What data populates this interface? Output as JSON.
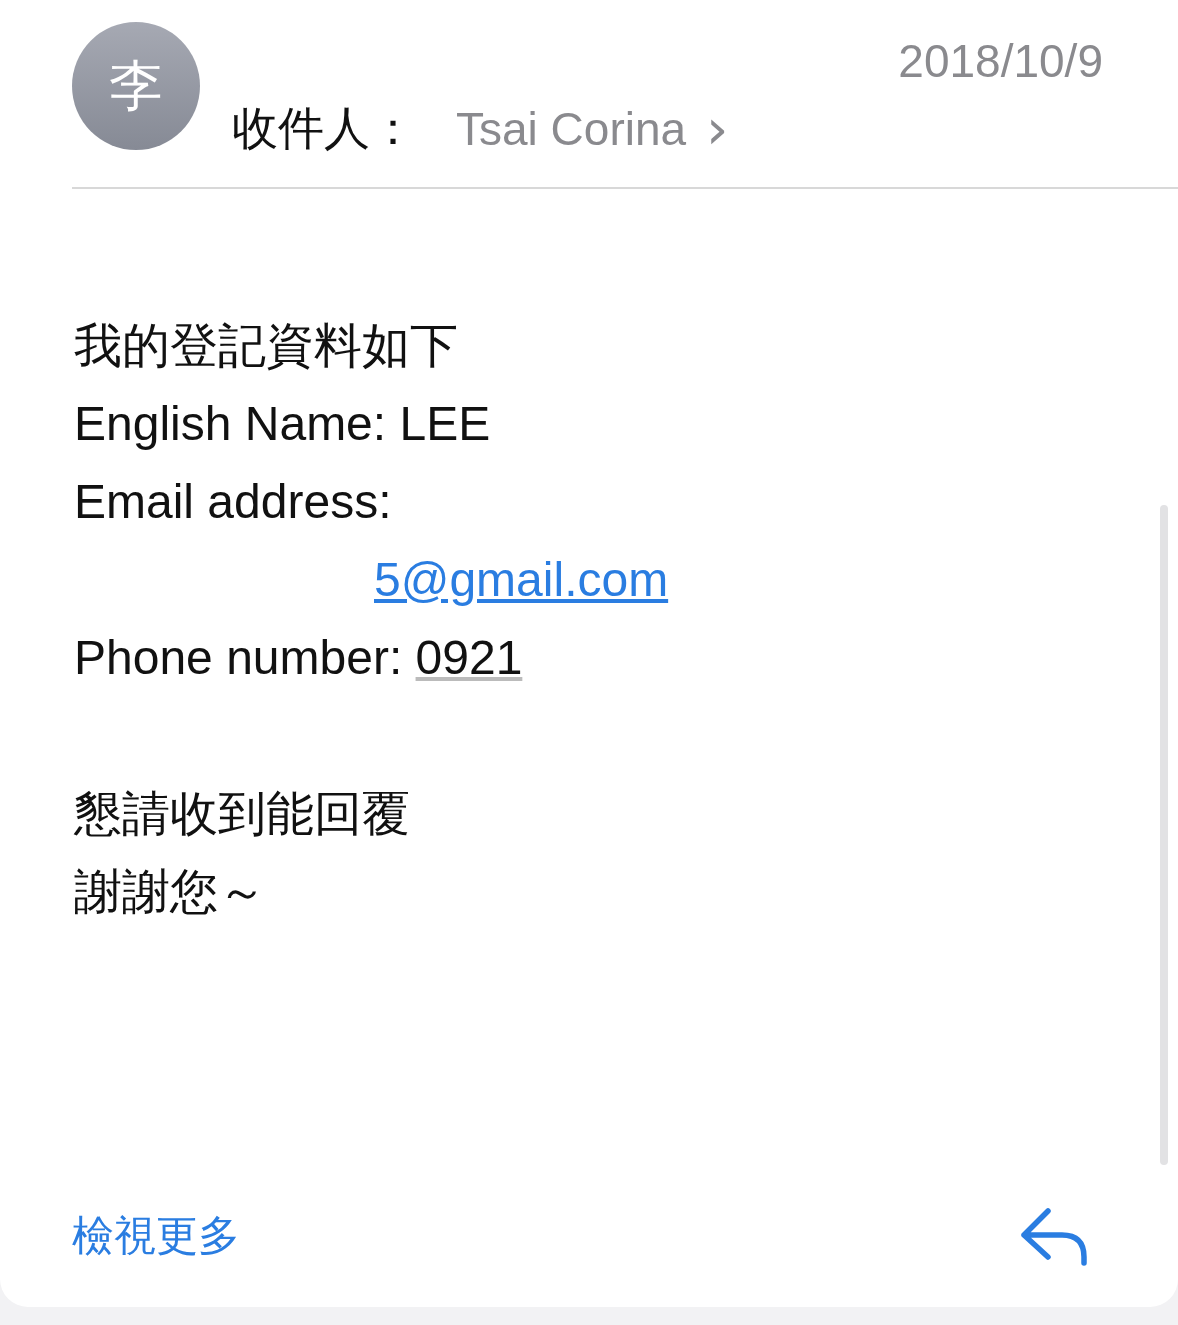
{
  "header": {
    "avatar": "李",
    "to_label": "收件人：",
    "recipient": "Tsai Corina",
    "chevron": "›",
    "date": "2018/10/9"
  },
  "body": [
    {
      "kind": "text",
      "text": "我的登記資料如下"
    },
    {
      "kind": "text",
      "text": "English Name:  LEE"
    },
    {
      "kind": "text",
      "text": "Email address:"
    },
    {
      "kind": "link",
      "text": "5@gmail.com"
    },
    {
      "kind": "phone",
      "label": "Phone number:  ",
      "text": "0921"
    },
    {
      "kind": "blank"
    },
    {
      "kind": "text",
      "text": "懇請收到能回覆"
    },
    {
      "kind": "text",
      "text": "謝謝您～"
    }
  ],
  "footer": {
    "more": "檢視更多"
  }
}
